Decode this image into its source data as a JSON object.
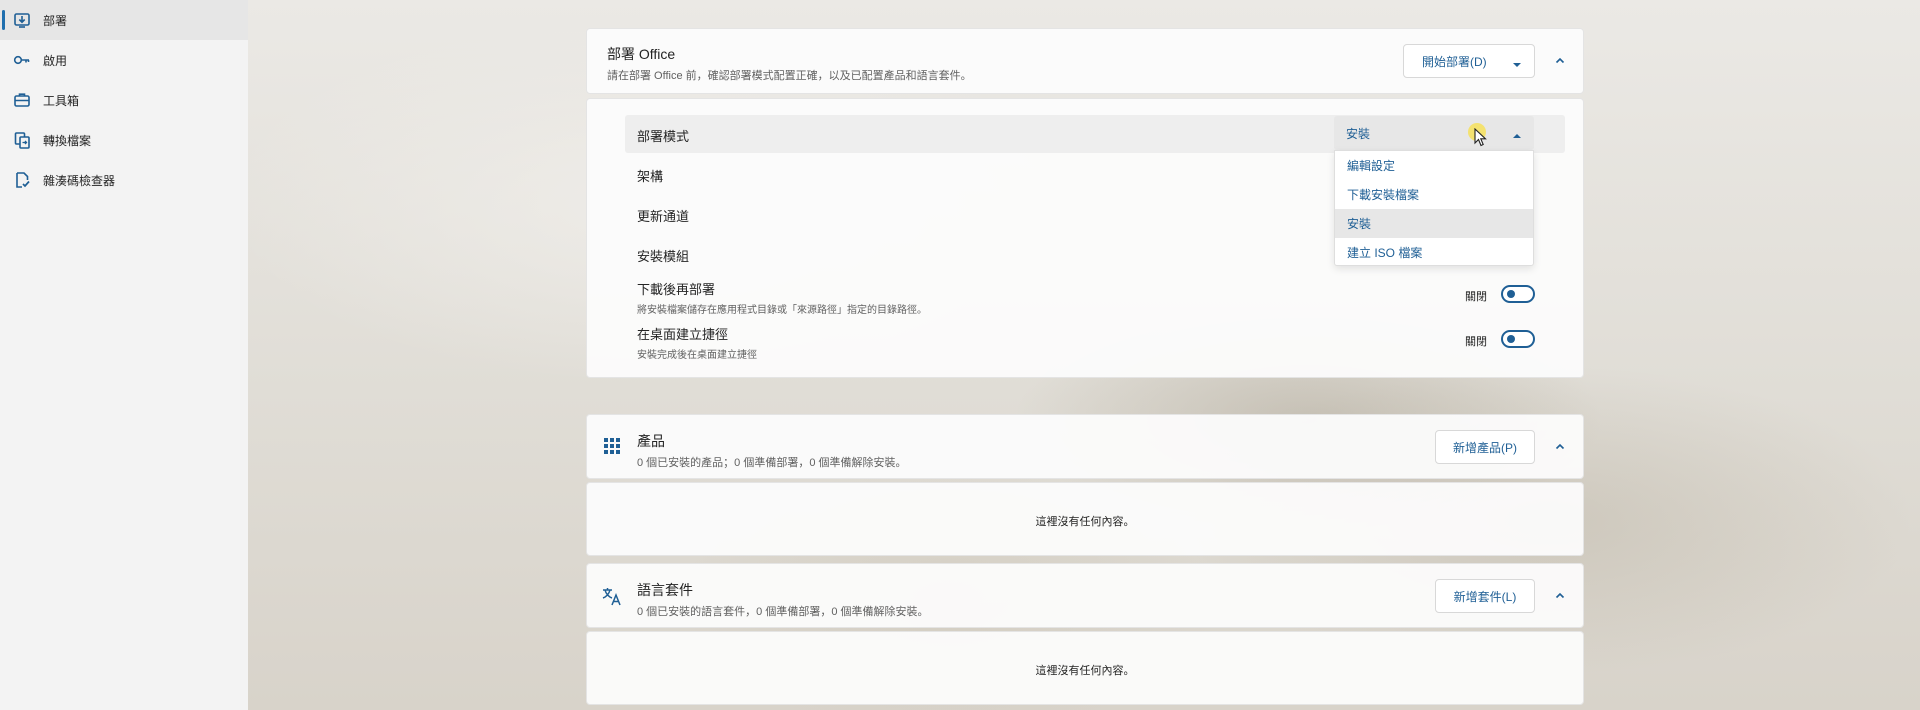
{
  "sidebar": {
    "items": [
      {
        "label": "部署",
        "icon": "deploy-icon",
        "active": true
      },
      {
        "label": "啟用",
        "icon": "key-icon",
        "active": false
      },
      {
        "label": "工具箱",
        "icon": "toolbox-icon",
        "active": false
      },
      {
        "label": "轉換檔案",
        "icon": "convert-file-icon",
        "active": false
      },
      {
        "label": "雜湊碼檢查器",
        "icon": "checksum-icon",
        "active": false
      }
    ]
  },
  "deploy_card": {
    "title": "部署 Office",
    "subtitle": "請在部署 Office 前，確認部署模式配置正確，以及已配置產品和語言套件。",
    "start_button": "開始部署(D)",
    "settings": {
      "mode_label": "部署模式",
      "mode_value": "安裝",
      "arch_label": "架構",
      "channel_label": "更新通道",
      "module_label": "安裝模組",
      "download_then_deploy": {
        "label": "下載後再部署",
        "sub": "將安裝檔案儲存在應用程式目錄或「來源路徑」指定的目錄路徑。",
        "state": "關閉"
      },
      "desktop_shortcut": {
        "label": "在桌面建立捷徑",
        "sub": "安裝完成後在桌面建立捷徑",
        "state": "關閉"
      }
    },
    "mode_options": [
      "編輯設定",
      "下載安裝檔案",
      "安裝",
      "建立 ISO 檔案"
    ]
  },
  "products_card": {
    "title": "產品",
    "subtitle": "0 個已安裝的產品；0 個準備部署，0 個準備解除安裝。",
    "add_button": "新增產品(P)",
    "empty_text": "這裡沒有任何內容。"
  },
  "language_card": {
    "title": "語言套件",
    "subtitle": "0 個已安裝的語言套件，0 個準備部署，0 個準備解除安裝。",
    "add_button": "新增套件(L)",
    "empty_text": "這裡沒有任何內容。"
  },
  "colors": {
    "accent": "#1f5f95",
    "active_indicator": "#1f6fae"
  }
}
